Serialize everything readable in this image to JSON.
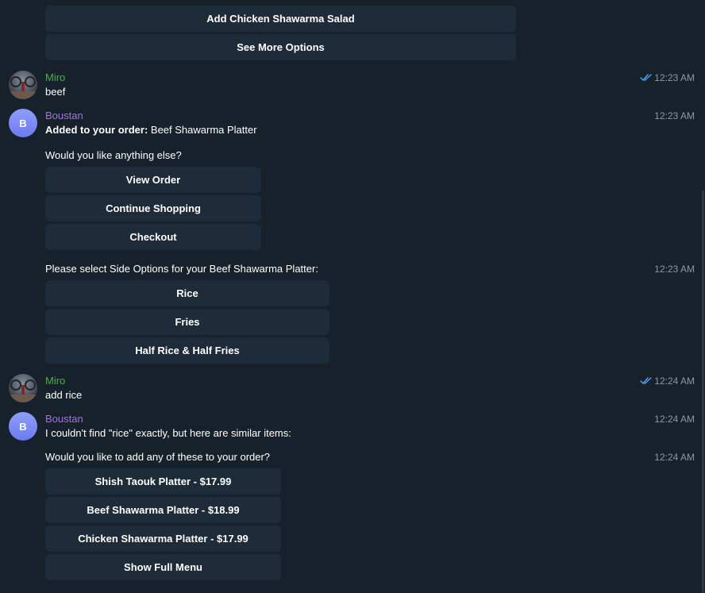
{
  "top_buttons": [
    "Add Chicken Shawarma Salad",
    "See More Options"
  ],
  "messages": {
    "m1": {
      "sender": "Miro",
      "text": "beef",
      "time": "12:23 AM",
      "read_icon": "double-check-icon"
    },
    "m2": {
      "sender": "Boustan",
      "avatar_letter": "B",
      "bold": "Added to your order:",
      "rest": " Beef Shawarma Platter",
      "followup": "Would you like anything else?",
      "time": "12:23 AM",
      "buttons": [
        "View Order",
        "Continue Shopping",
        "Checkout"
      ]
    },
    "m3": {
      "text": "Please select Side Options for your Beef Shawarma Platter:",
      "time": "12:23 AM",
      "buttons": [
        "Rice",
        "Fries",
        "Half Rice & Half Fries"
      ]
    },
    "m4": {
      "sender": "Miro",
      "text": "add rice",
      "time": "12:24 AM",
      "read_icon": "double-check-icon"
    },
    "m5": {
      "sender": "Boustan",
      "avatar_letter": "B",
      "text": "I couldn't find \"rice\" exactly, but here are similar items:",
      "time": "12:24 AM"
    },
    "m6": {
      "text": "Would you like to add any of these to your order?",
      "time": "12:24 AM",
      "buttons": [
        "Shish Taouk Platter - $17.99",
        "Beef Shawarma Platter - $18.99",
        "Chicken Shawarma Platter - $17.99",
        "Show Full Menu"
      ]
    }
  },
  "colors": {
    "background": "#17212b",
    "button": "#1e2c3a",
    "miro_name": "#4fae4e",
    "boustan_name": "#a26fe6",
    "time": "#8a98a6",
    "read_check": "#4ea4f6"
  }
}
